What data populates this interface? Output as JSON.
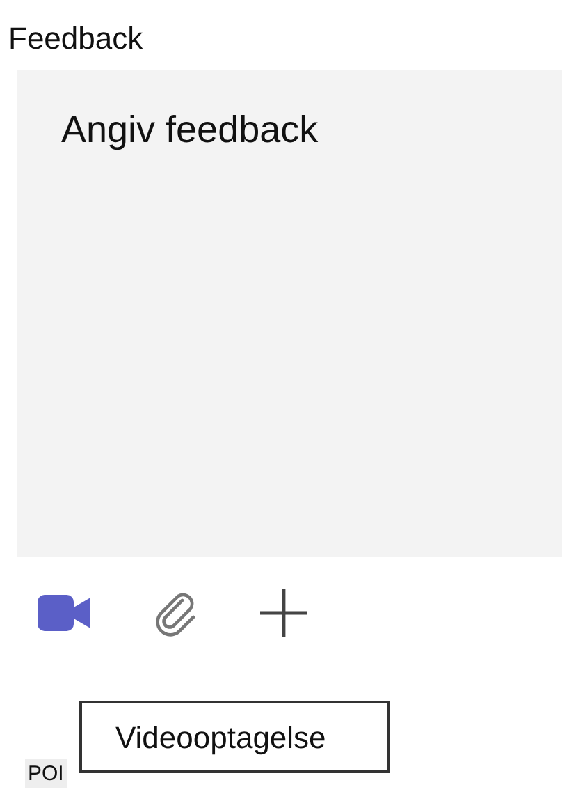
{
  "section": {
    "title": "Feedback"
  },
  "feedback_field": {
    "placeholder": "Angiv feedback"
  },
  "toolbar": [
    {
      "kind": "video"
    },
    {
      "kind": "attach"
    },
    {
      "kind": "add"
    }
  ],
  "tooltip": {
    "text": "Videooptagelse"
  },
  "tag": {
    "text": "POI"
  }
}
